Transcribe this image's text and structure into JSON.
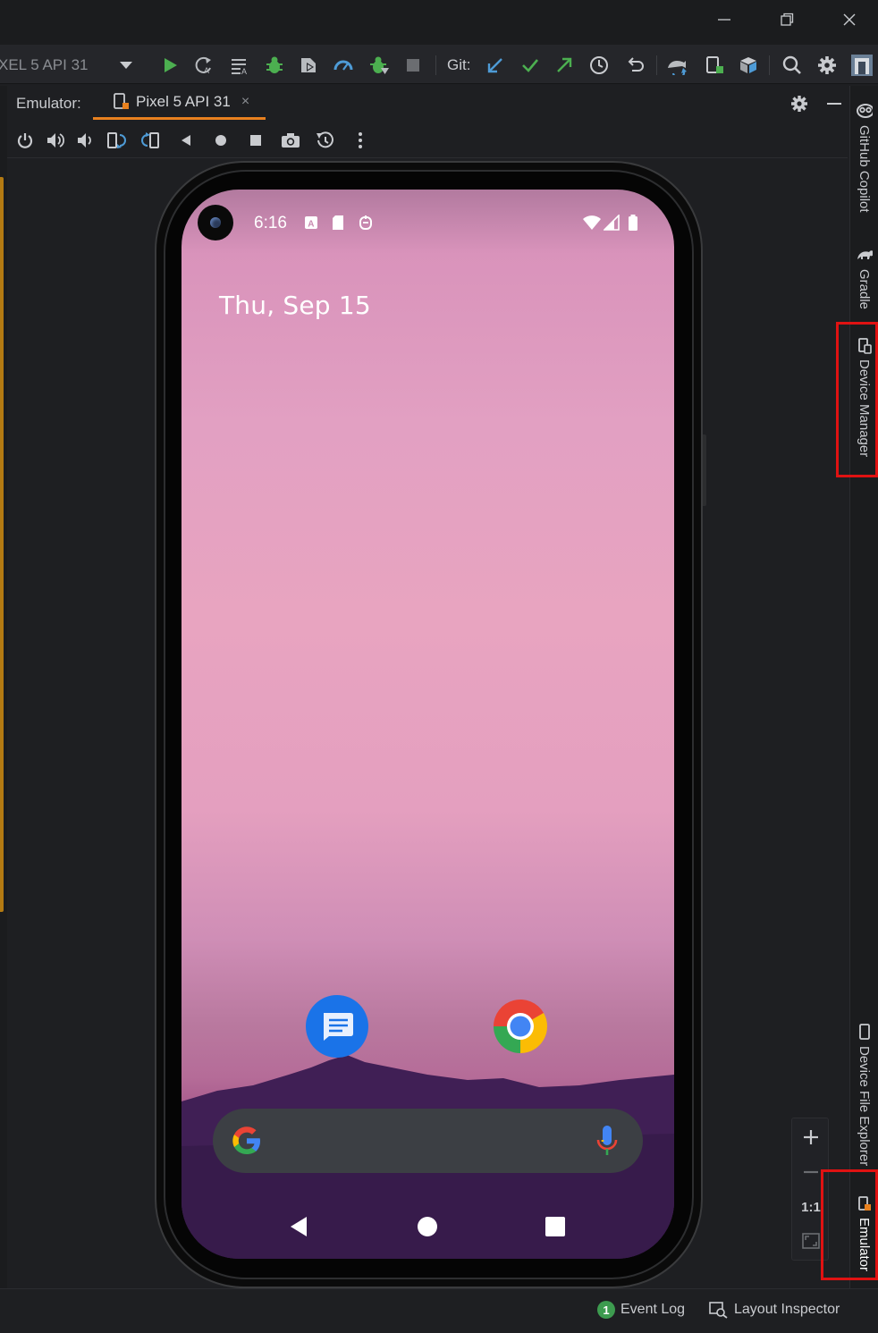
{
  "window": {
    "minimize_icon": "minimize-icon",
    "restore_icon": "restore-icon",
    "close_icon": "close-icon"
  },
  "toolbar": {
    "run_config": "XEL 5 API 31",
    "git_label": "Git:",
    "icons": [
      "run-icon",
      "apply-changes-icon",
      "apply-code-changes-icon",
      "debug-icon",
      "coverage-icon",
      "profile-icon",
      "attach-debugger-icon",
      "stop-icon",
      "git-update-icon",
      "git-commit-icon",
      "git-push-icon",
      "git-history-icon",
      "git-rollback-icon",
      "sync-gradle-icon",
      "device-manager-icon",
      "sdk-manager-icon",
      "search-icon",
      "settings-icon",
      "avatar"
    ]
  },
  "emulator": {
    "title": "Emulator:",
    "tab_label": "Pixel 5 API 31",
    "tab_close": "×",
    "controls": [
      "power-icon",
      "volume-up-icon",
      "volume-down-icon",
      "rotate-left-icon",
      "rotate-right-icon",
      "back-icon",
      "home-icon",
      "overview-icon",
      "screenshot-icon",
      "snapshot-icon",
      "more-icon"
    ]
  },
  "phone": {
    "status_time": "6:16",
    "date": "Thu, Sep 15",
    "apps": [
      {
        "name": "Messages",
        "icon": "messages-icon"
      },
      {
        "name": "Chrome",
        "icon": "chrome-icon"
      }
    ],
    "search_logo": "google-logo-icon",
    "mic_icon": "mic-icon"
  },
  "side_tools": {
    "copilot": "GitHub Copilot",
    "gradle": "Gradle",
    "device_manager": "Device Manager",
    "device_file_explorer": "Device File Explorer",
    "emulator": "Emulator"
  },
  "zoom": {
    "zoom_in": "+",
    "zoom_out": "−",
    "actual_size": "1:1"
  },
  "statusbar": {
    "event_log_count": "1",
    "event_log": "Event Log",
    "layout_inspector": "Layout Inspector"
  },
  "colors": {
    "accent_tab": "#e8811f",
    "highlight": "#e01212",
    "run_green": "#4caf50"
  }
}
